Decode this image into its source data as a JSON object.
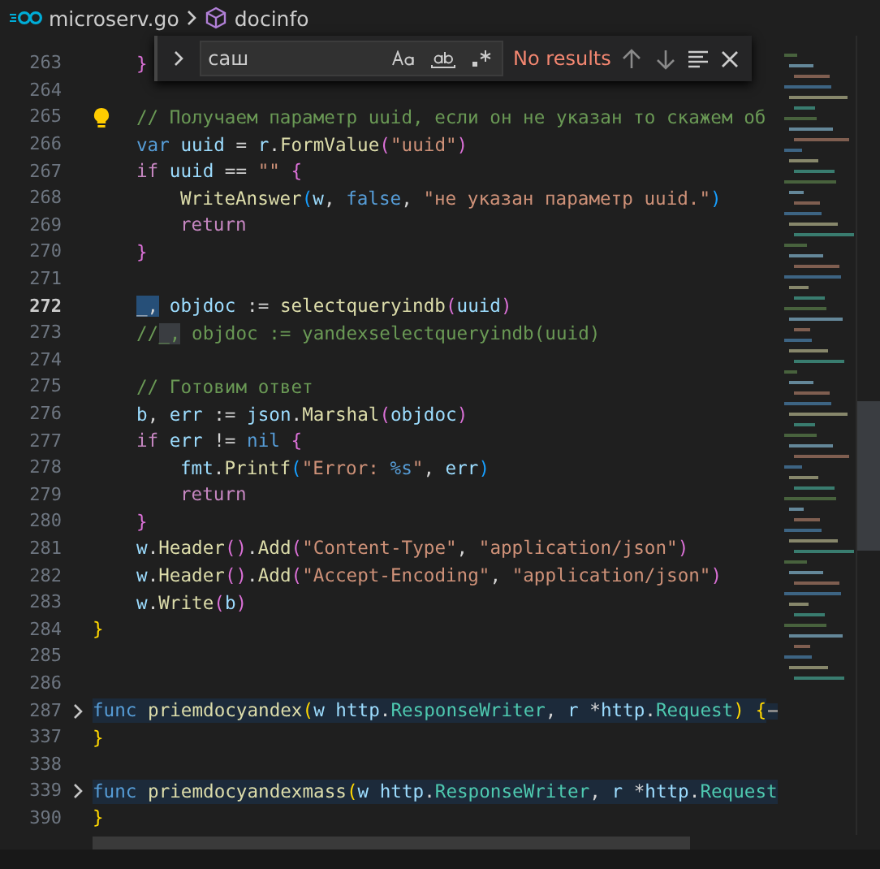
{
  "breadcrumb": [
    {
      "kind": "file",
      "label": "microserv.go"
    },
    {
      "kind": "symbol",
      "label": "docinfo"
    }
  ],
  "find": {
    "value": "саш",
    "match_case": false,
    "whole_word": false,
    "regex": false,
    "status": "No results"
  },
  "lines": [
    {
      "children": [
        {
          "number": "263",
          "tokens": [
            {
              "kind": "br2",
              "text": "}"
            }
          ]
        },
        {
          "number": "264"
        },
        {
          "number": "265",
          "lightbulb": true,
          "tokens": [
            {
              "kind": "comment",
              "text": "// Получаем параметр uuid, если он не указан то скажем об"
            }
          ]
        },
        {
          "number": "266",
          "tokens": [
            {
              "kind": "kw",
              "text": "var"
            },
            {
              "kind": "var",
              "text": " uuid"
            },
            {
              "kind": "plain",
              "text": " = "
            },
            {
              "kind": "var",
              "text": "r"
            },
            {
              "kind": "plain",
              "text": "."
            },
            {
              "kind": "fn",
              "text": "FormValue"
            },
            {
              "kind": "br2",
              "text": "("
            },
            {
              "kind": "str",
              "text": "\"uuid\""
            },
            {
              "kind": "br2",
              "text": ")"
            }
          ]
        },
        {
          "number": "267",
          "tokens": [
            {
              "kind": "ctrl",
              "text": "if"
            },
            {
              "kind": "var",
              "text": " uuid"
            },
            {
              "kind": "plain",
              "text": " == "
            },
            {
              "kind": "str",
              "text": "\"\""
            },
            {
              "kind": "br2",
              "text": " {"
            }
          ],
          "children": [
            {
              "number": "268",
              "tokens": [
                {
                  "kind": "fn",
                  "text": "WriteAnswer"
                },
                {
                  "kind": "br3",
                  "text": "("
                },
                {
                  "kind": "var",
                  "text": "w"
                },
                {
                  "kind": "plain",
                  "text": ", "
                },
                {
                  "kind": "kw",
                  "text": "false"
                },
                {
                  "kind": "plain",
                  "text": ", "
                },
                {
                  "kind": "str",
                  "text": "\"не указан параметр uuid.\""
                },
                {
                  "kind": "br3",
                  "text": ")"
                }
              ]
            },
            {
              "number": "269",
              "tokens": [
                {
                  "kind": "ctrl",
                  "text": "return"
                }
              ]
            }
          ]
        },
        {
          "number": "270",
          "tokens": [
            {
              "kind": "br2",
              "text": "}"
            }
          ]
        },
        {
          "number": "271"
        },
        {
          "number": "272",
          "current": true,
          "tokens": [
            {
              "kind": "sel",
              "text": "_,"
            },
            {
              "kind": "var",
              "text": " objdoc"
            },
            {
              "kind": "plain",
              "text": " := "
            },
            {
              "kind": "fn",
              "text": "selectqueryindb"
            },
            {
              "kind": "br2",
              "text": "("
            },
            {
              "kind": "var",
              "text": "uuid"
            },
            {
              "kind": "br2",
              "text": ")"
            }
          ]
        },
        {
          "number": "273",
          "tokens": [
            {
              "kind": "comment",
              "text": "//"
            },
            {
              "kind": "csel",
              "text": "_,"
            },
            {
              "kind": "comment",
              "text": " objdoc := yandexselectqueryindb(uuid)"
            }
          ]
        },
        {
          "number": "274"
        },
        {
          "number": "275",
          "tokens": [
            {
              "kind": "comment",
              "text": "// Готовим ответ"
            }
          ]
        },
        {
          "number": "276",
          "tokens": [
            {
              "kind": "var",
              "text": "b"
            },
            {
              "kind": "plain",
              "text": ", "
            },
            {
              "kind": "var",
              "text": "err"
            },
            {
              "kind": "plain",
              "text": " := "
            },
            {
              "kind": "var",
              "text": "json"
            },
            {
              "kind": "plain",
              "text": "."
            },
            {
              "kind": "fn",
              "text": "Marshal"
            },
            {
              "kind": "br2",
              "text": "("
            },
            {
              "kind": "var",
              "text": "objdoc"
            },
            {
              "kind": "br2",
              "text": ")"
            }
          ]
        },
        {
          "number": "277",
          "tokens": [
            {
              "kind": "ctrl",
              "text": "if"
            },
            {
              "kind": "var",
              "text": " err"
            },
            {
              "kind": "plain",
              "text": " != "
            },
            {
              "kind": "kw",
              "text": "nil"
            },
            {
              "kind": "br2",
              "text": " {"
            }
          ],
          "children": [
            {
              "number": "278",
              "tokens": [
                {
                  "kind": "var",
                  "text": "fmt"
                },
                {
                  "kind": "plain",
                  "text": "."
                },
                {
                  "kind": "fn",
                  "text": "Printf"
                },
                {
                  "kind": "br3",
                  "text": "("
                },
                {
                  "kind": "str",
                  "text": "\"Error: "
                },
                {
                  "kind": "kw",
                  "text": "%s"
                },
                {
                  "kind": "str",
                  "text": "\""
                },
                {
                  "kind": "plain",
                  "text": ", "
                },
                {
                  "kind": "var",
                  "text": "err"
                },
                {
                  "kind": "br3",
                  "text": ")"
                }
              ]
            },
            {
              "number": "279",
              "tokens": [
                {
                  "kind": "ctrl",
                  "text": "return"
                }
              ]
            }
          ]
        },
        {
          "number": "280",
          "tokens": [
            {
              "kind": "br2",
              "text": "}"
            }
          ]
        },
        {
          "number": "281",
          "tokens": [
            {
              "kind": "var",
              "text": "w"
            },
            {
              "kind": "plain",
              "text": "."
            },
            {
              "kind": "fn",
              "text": "Header"
            },
            {
              "kind": "br2",
              "text": "()"
            },
            {
              "kind": "plain",
              "text": "."
            },
            {
              "kind": "fn",
              "text": "Add"
            },
            {
              "kind": "br2",
              "text": "("
            },
            {
              "kind": "str",
              "text": "\"Content-Type\""
            },
            {
              "kind": "plain",
              "text": ", "
            },
            {
              "kind": "str",
              "text": "\"application/json\""
            },
            {
              "kind": "br2",
              "text": ")"
            }
          ]
        },
        {
          "number": "282",
          "tokens": [
            {
              "kind": "var",
              "text": "w"
            },
            {
              "kind": "plain",
              "text": "."
            },
            {
              "kind": "fn",
              "text": "Header"
            },
            {
              "kind": "br2",
              "text": "()"
            },
            {
              "kind": "plain",
              "text": "."
            },
            {
              "kind": "fn",
              "text": "Add"
            },
            {
              "kind": "br2",
              "text": "("
            },
            {
              "kind": "str",
              "text": "\"Accept-Encoding\""
            },
            {
              "kind": "plain",
              "text": ", "
            },
            {
              "kind": "str",
              "text": "\"application/json\""
            },
            {
              "kind": "br2",
              "text": ")"
            }
          ]
        },
        {
          "number": "283",
          "tokens": [
            {
              "kind": "var",
              "text": "w"
            },
            {
              "kind": "plain",
              "text": "."
            },
            {
              "kind": "fn",
              "text": "Write"
            },
            {
              "kind": "br2",
              "text": "("
            },
            {
              "kind": "var",
              "text": "b"
            },
            {
              "kind": "br2",
              "text": ")"
            }
          ]
        }
      ]
    },
    {
      "number": "284",
      "tokens": [
        {
          "kind": "br1",
          "text": "}"
        }
      ]
    },
    {
      "number": "285"
    },
    {
      "number": "286"
    },
    {
      "number": "287",
      "folded": true,
      "tokens": [
        {
          "kind": "kw",
          "text": "func"
        },
        {
          "kind": "fn",
          "text": " priemdocyandex"
        },
        {
          "kind": "br1",
          "text": "("
        },
        {
          "kind": "var",
          "text": "w"
        },
        {
          "kind": "var",
          "text": " http"
        },
        {
          "kind": "plain",
          "text": "."
        },
        {
          "kind": "type",
          "text": "ResponseWriter"
        },
        {
          "kind": "plain",
          "text": ", "
        },
        {
          "kind": "var",
          "text": "r"
        },
        {
          "kind": "plain",
          "text": " *"
        },
        {
          "kind": "var",
          "text": "http"
        },
        {
          "kind": "plain",
          "text": "."
        },
        {
          "kind": "type",
          "text": "Request"
        },
        {
          "kind": "br1",
          "text": ")"
        },
        {
          "kind": "br1",
          "text": " {"
        }
      ]
    },
    {
      "number": "337",
      "tokens": [
        {
          "kind": "br1",
          "text": "}"
        }
      ]
    },
    {
      "number": "338"
    },
    {
      "number": "339",
      "folded": true,
      "tokens": [
        {
          "kind": "kw",
          "text": "func"
        },
        {
          "kind": "fn",
          "text": " priemdocyandexmass"
        },
        {
          "kind": "br1",
          "text": "("
        },
        {
          "kind": "var",
          "text": "w"
        },
        {
          "kind": "var",
          "text": " http"
        },
        {
          "kind": "plain",
          "text": "."
        },
        {
          "kind": "type",
          "text": "ResponseWriter"
        },
        {
          "kind": "plain",
          "text": ", "
        },
        {
          "kind": "var",
          "text": "r"
        },
        {
          "kind": "plain",
          "text": " *"
        },
        {
          "kind": "var",
          "text": "http"
        },
        {
          "kind": "plain",
          "text": "."
        },
        {
          "kind": "type",
          "text": "Request"
        }
      ]
    },
    {
      "number": "390",
      "tokens": [
        {
          "kind": "br1",
          "text": "}"
        }
      ]
    }
  ]
}
